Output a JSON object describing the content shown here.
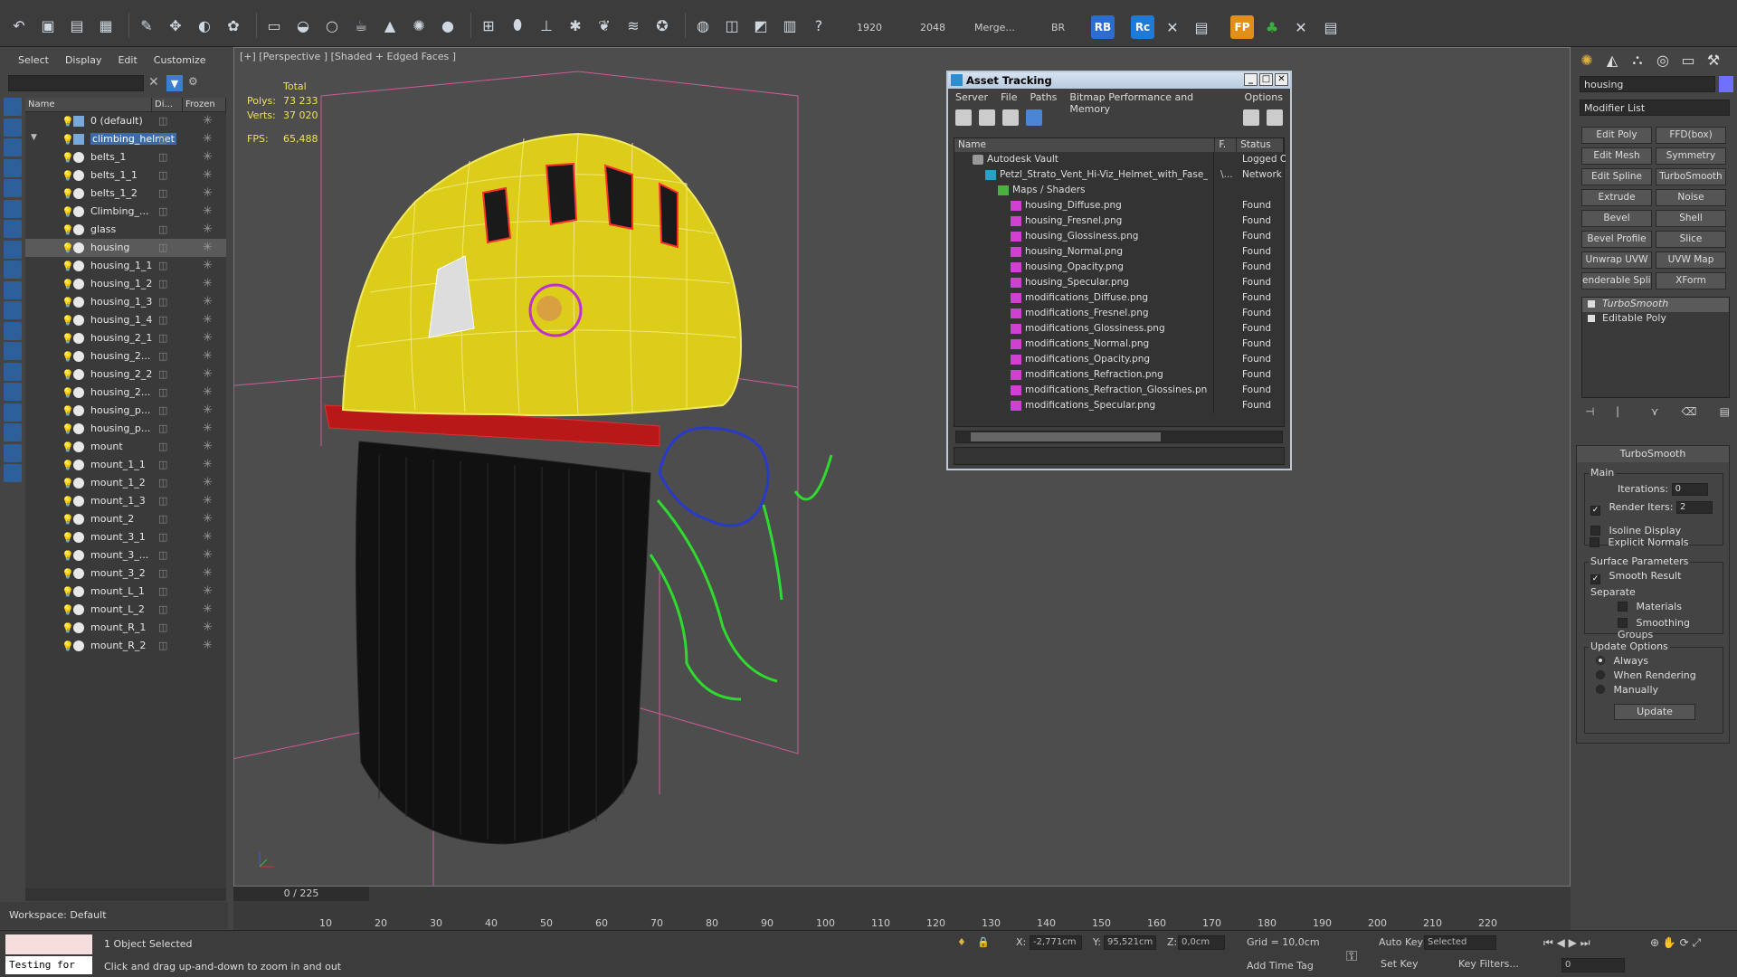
{
  "toolbar": {
    "res1": "1920",
    "res2": "2048",
    "merge": "Merge...",
    "br": "BR",
    "rb": "RB",
    "rc": "Rc",
    "fp": "FP"
  },
  "explorer": {
    "menu": [
      "Select",
      "Display",
      "Edit",
      "Customize"
    ],
    "columns": {
      "name": "Name",
      "display": "Di...",
      "frozen": "Frozen"
    },
    "rows": [
      {
        "label": "0 (default)",
        "type": "layer",
        "depth": 0
      },
      {
        "label": "climbing_helmet",
        "type": "layer",
        "depth": 0,
        "highlight": true
      },
      {
        "label": "belts_1",
        "type": "obj",
        "depth": 1
      },
      {
        "label": "belts_1_1",
        "type": "obj",
        "depth": 1
      },
      {
        "label": "belts_1_2",
        "type": "obj",
        "depth": 1
      },
      {
        "label": "Climbing_...",
        "type": "obj",
        "depth": 1
      },
      {
        "label": "glass",
        "type": "obj",
        "depth": 1
      },
      {
        "label": "housing",
        "type": "obj",
        "depth": 1,
        "selected": true
      },
      {
        "label": "housing_1_1",
        "type": "obj",
        "depth": 1
      },
      {
        "label": "housing_1_2",
        "type": "obj",
        "depth": 1
      },
      {
        "label": "housing_1_3",
        "type": "obj",
        "depth": 1
      },
      {
        "label": "housing_1_4",
        "type": "obj",
        "depth": 1
      },
      {
        "label": "housing_2_1",
        "type": "obj",
        "depth": 1
      },
      {
        "label": "housing_2...",
        "type": "obj",
        "depth": 1
      },
      {
        "label": "housing_2_2",
        "type": "obj",
        "depth": 1
      },
      {
        "label": "housing_2...",
        "type": "obj",
        "depth": 1
      },
      {
        "label": "housing_p...",
        "type": "obj",
        "depth": 1
      },
      {
        "label": "housing_p...",
        "type": "obj",
        "depth": 1
      },
      {
        "label": "mount",
        "type": "obj",
        "depth": 1
      },
      {
        "label": "mount_1_1",
        "type": "obj",
        "depth": 1
      },
      {
        "label": "mount_1_2",
        "type": "obj",
        "depth": 1
      },
      {
        "label": "mount_1_3",
        "type": "obj",
        "depth": 1
      },
      {
        "label": "mount_2",
        "type": "obj",
        "depth": 1
      },
      {
        "label": "mount_3_1",
        "type": "obj",
        "depth": 1
      },
      {
        "label": "mount_3_...",
        "type": "obj",
        "depth": 1
      },
      {
        "label": "mount_3_2",
        "type": "obj",
        "depth": 1
      },
      {
        "label": "mount_L_1",
        "type": "obj",
        "depth": 1
      },
      {
        "label": "mount_L_2",
        "type": "obj",
        "depth": 1
      },
      {
        "label": "mount_R_1",
        "type": "obj",
        "depth": 1
      },
      {
        "label": "mount_R_2",
        "type": "obj",
        "depth": 1
      }
    ],
    "workspace": "Workspace: Default"
  },
  "viewport": {
    "label": "[+] [Perspective ] [Shaded + Edged Faces ]",
    "stats": {
      "total_label": "Total",
      "polys_label": "Polys:",
      "polys": "73 233",
      "verts_label": "Verts:",
      "verts": "37 020",
      "fps_label": "FPS:",
      "fps": "65,488"
    }
  },
  "timeline": {
    "slider": "0 / 225",
    "ticks": [
      "10",
      "20",
      "30",
      "40",
      "50",
      "60",
      "70",
      "80",
      "90",
      "100",
      "110",
      "120",
      "130",
      "140",
      "150",
      "160",
      "170",
      "180",
      "190",
      "200",
      "210",
      "220"
    ]
  },
  "status": {
    "script_text": "Testing for",
    "selected": "1 Object Selected",
    "hint": "Click and drag up-and-down to zoom in and out",
    "x_label": "X:",
    "x": "-2,771cm",
    "y_label": "Y:",
    "y": "95,521cm",
    "z_label": "Z:",
    "z": "0,0cm",
    "grid": "Grid = 10,0cm",
    "add_time_tag": "Add Time Tag",
    "auto_key": "Auto Key",
    "set_key": "Set Key",
    "key_mode": "Selected",
    "key_filters": "Key Filters...",
    "frame": "0"
  },
  "command": {
    "object_name": "housing",
    "modifier_list": "Modifier List",
    "buttons": [
      "Edit Poly",
      "FFD(box)",
      "Edit Mesh",
      "Symmetry",
      "Edit Spline",
      "TurboSmooth",
      "Extrude",
      "Noise",
      "Bevel",
      "Shell",
      "Bevel Profile",
      "Slice",
      "Unwrap UVW",
      "UVW Map",
      "enderable Splin",
      "XForm"
    ],
    "stack": [
      {
        "label": "TurboSmooth",
        "active": true
      },
      {
        "label": "Editable Poly",
        "active": false
      }
    ],
    "turbosmooth": {
      "title": "TurboSmooth",
      "main": "Main",
      "iterations_label": "Iterations:",
      "iterations": "0",
      "render_iters_label": "Render Iters:",
      "render_iters": "2",
      "isoline": "Isoline Display",
      "explicit": "Explicit Normals",
      "surface": "Surface Parameters",
      "smooth_result": "Smooth Result",
      "separate": "Separate",
      "materials": "Materials",
      "smoothing_groups": "Smoothing Groups",
      "update_options": "Update Options",
      "always": "Always",
      "when_rendering": "When Rendering",
      "manually": "Manually",
      "update": "Update"
    }
  },
  "asset": {
    "title": "Asset Tracking",
    "menu": [
      "Server",
      "File",
      "Paths",
      "Bitmap Performance and Memory",
      "Options"
    ],
    "columns": {
      "name": "Name",
      "first": "F.",
      "status": "Status"
    },
    "rows": [
      {
        "name": "Autodesk Vault",
        "status": "Logged Ou",
        "icon": "vault",
        "indent": 20,
        "first": ""
      },
      {
        "name": "Petzl_Strato_Vent_Hi-Viz_Helmet_with_Fase_...",
        "status": "Network P",
        "icon": "max",
        "indent": 34,
        "first": "\\..."
      },
      {
        "name": "Maps / Shaders",
        "status": "",
        "icon": "maps",
        "indent": 48,
        "first": ""
      },
      {
        "name": "housing_Diffuse.png",
        "status": "Found",
        "icon": "png",
        "indent": 62,
        "first": ""
      },
      {
        "name": "housing_Fresnel.png",
        "status": "Found",
        "icon": "png",
        "indent": 62,
        "first": ""
      },
      {
        "name": "housing_Glossiness.png",
        "status": "Found",
        "icon": "png",
        "indent": 62,
        "first": ""
      },
      {
        "name": "housing_Normal.png",
        "status": "Found",
        "icon": "png",
        "indent": 62,
        "first": ""
      },
      {
        "name": "housing_Opacity.png",
        "status": "Found",
        "icon": "png",
        "indent": 62,
        "first": ""
      },
      {
        "name": "housing_Specular.png",
        "status": "Found",
        "icon": "png",
        "indent": 62,
        "first": ""
      },
      {
        "name": "modifications_Diffuse.png",
        "status": "Found",
        "icon": "png",
        "indent": 62,
        "first": ""
      },
      {
        "name": "modifications_Fresnel.png",
        "status": "Found",
        "icon": "png",
        "indent": 62,
        "first": ""
      },
      {
        "name": "modifications_Glossiness.png",
        "status": "Found",
        "icon": "png",
        "indent": 62,
        "first": ""
      },
      {
        "name": "modifications_Normal.png",
        "status": "Found",
        "icon": "png",
        "indent": 62,
        "first": ""
      },
      {
        "name": "modifications_Opacity.png",
        "status": "Found",
        "icon": "png",
        "indent": 62,
        "first": ""
      },
      {
        "name": "modifications_Refraction.png",
        "status": "Found",
        "icon": "png",
        "indent": 62,
        "first": ""
      },
      {
        "name": "modifications_Refraction_Glossines.png",
        "status": "Found",
        "icon": "png",
        "indent": 62,
        "first": ""
      },
      {
        "name": "modifications_Specular.png",
        "status": "Found",
        "icon": "png",
        "indent": 62,
        "first": ""
      }
    ]
  }
}
